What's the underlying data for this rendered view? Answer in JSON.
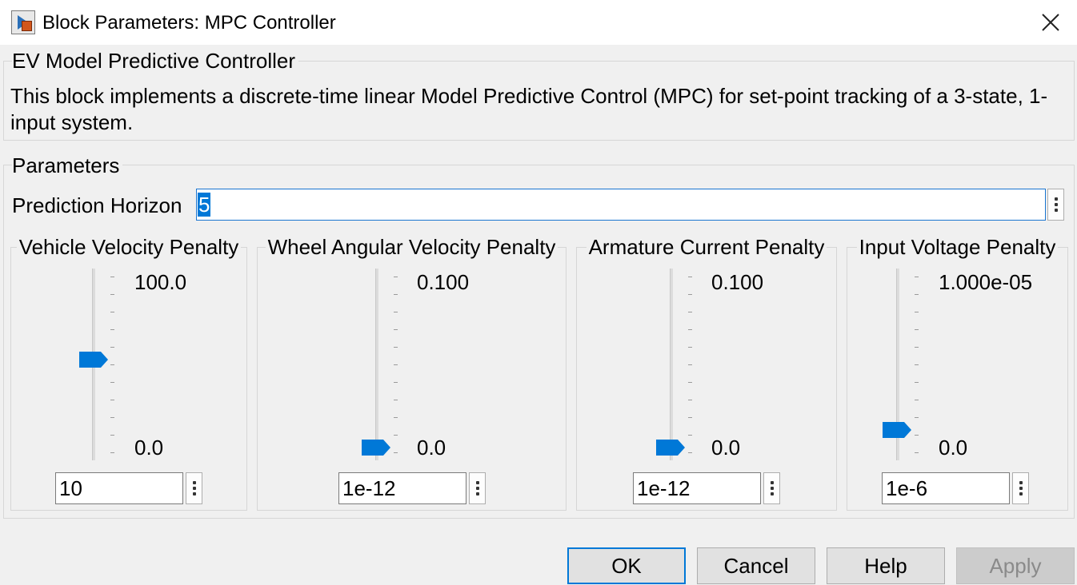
{
  "window": {
    "title": "Block Parameters: MPC Controller",
    "app_icon": "simulink-block-icon",
    "close_icon": "close-icon"
  },
  "description_group": {
    "label": "EV Model Predictive Controller",
    "text": "This block implements a discrete-time linear Model Predictive Control (MPC) for set-point tracking of a 3-state, 1-input system."
  },
  "parameters_group": {
    "label": "Parameters",
    "prediction_horizon": {
      "label": "Prediction Horizon",
      "value": "5"
    }
  },
  "sliders": [
    {
      "title": "Vehicle Velocity Penalty",
      "max_label": "100.0",
      "min_label": "0.0",
      "value": "10",
      "position_fraction": 0.5
    },
    {
      "title": "Wheel Angular Velocity Penalty",
      "max_label": "0.100",
      "min_label": "0.0",
      "value": "1e-12",
      "position_fraction": 0.0
    },
    {
      "title": "Armature Current Penalty",
      "max_label": "0.100",
      "min_label": "0.0",
      "value": "1e-12",
      "position_fraction": 0.0
    },
    {
      "title": "Input Voltage Penalty",
      "max_label": "1.000e-05",
      "min_label": "0.0",
      "value": "1e-6",
      "position_fraction": 0.1
    }
  ],
  "buttons": {
    "ok": "OK",
    "cancel": "Cancel",
    "help": "Help",
    "apply": "Apply"
  },
  "colors": {
    "accent": "#0078d7",
    "background": "#f0f0f0"
  }
}
